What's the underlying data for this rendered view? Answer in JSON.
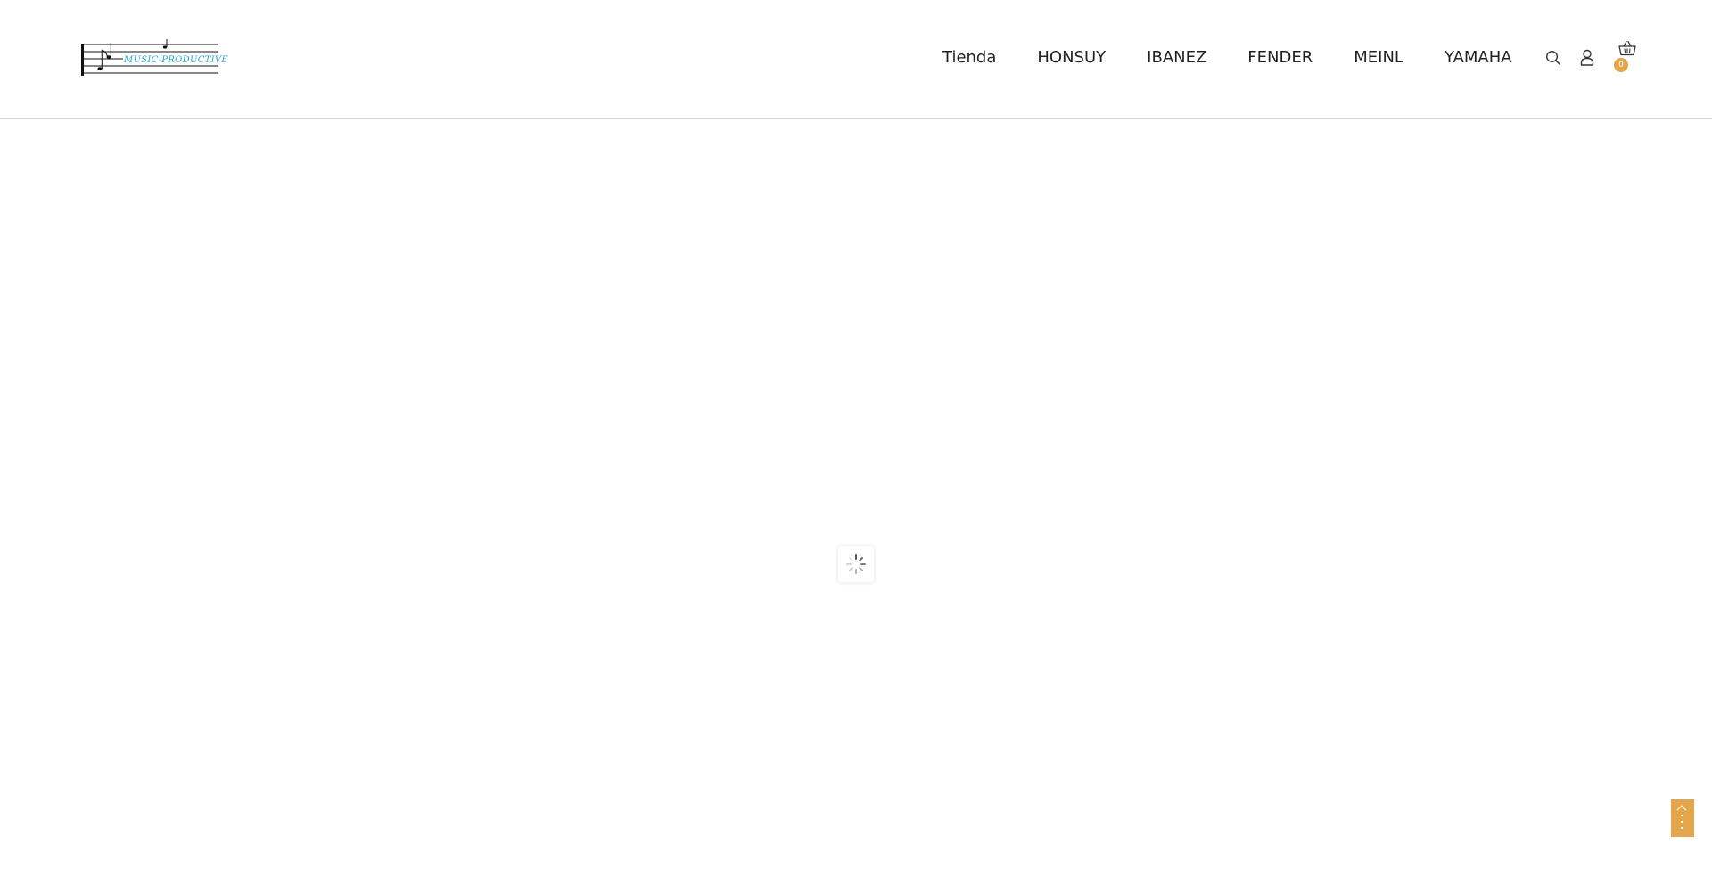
{
  "header": {
    "logo_text": "MUSIC-PRODUCTIVE"
  },
  "nav": {
    "items": [
      "Tienda",
      "HONSUY",
      "IBANEZ",
      "FENDER",
      "MEINL",
      "YAMAHA"
    ]
  },
  "actions": {
    "search_icon": "search-icon",
    "account_icon": "user-icon",
    "cart_icon": "basket-icon",
    "cart_count": "0"
  },
  "loader": {
    "icon": "spinner-icon"
  },
  "scroll_top": {
    "icon": "chevron-up-icon"
  },
  "colors": {
    "accent": "#e4a64a",
    "logo_text": "#2aa7d1",
    "nav_text": "#222222",
    "header_border": "#d9d9d9"
  }
}
